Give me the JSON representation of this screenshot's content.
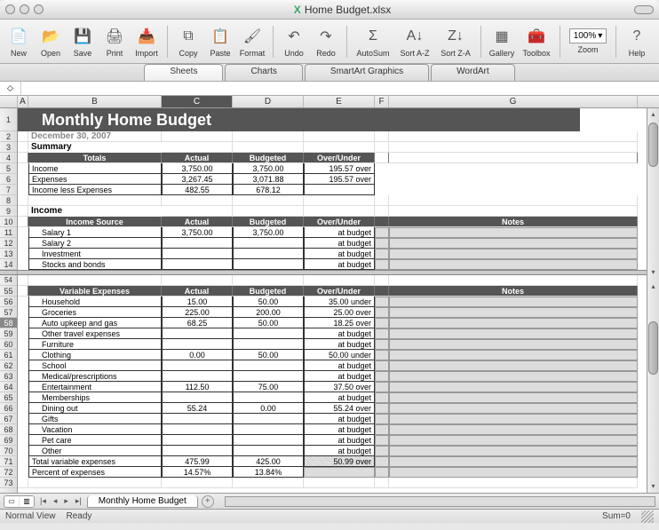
{
  "window": {
    "title": "Home Budget.xlsx"
  },
  "toolbar": {
    "items": [
      {
        "name": "new-button",
        "icon": "📄",
        "label": "New"
      },
      {
        "name": "open-button",
        "icon": "📂",
        "label": "Open"
      },
      {
        "name": "save-button",
        "icon": "💾",
        "label": "Save"
      },
      {
        "name": "print-button",
        "icon": "🖨",
        "label": "Print"
      },
      {
        "name": "import-button",
        "icon": "📥",
        "label": "Import"
      }
    ],
    "items2": [
      {
        "name": "copy-button",
        "icon": "⧉",
        "label": "Copy"
      },
      {
        "name": "paste-button",
        "icon": "📋",
        "label": "Paste"
      },
      {
        "name": "format-button",
        "icon": "🖌",
        "label": "Format"
      }
    ],
    "items3": [
      {
        "name": "undo-button",
        "icon": "↶",
        "label": "Undo"
      },
      {
        "name": "redo-button",
        "icon": "↷",
        "label": "Redo"
      }
    ],
    "items4": [
      {
        "name": "autosum-button",
        "icon": "Σ",
        "label": "AutoSum"
      },
      {
        "name": "sort-az-button",
        "icon": "A↓",
        "label": "Sort A-Z"
      },
      {
        "name": "sort-za-button",
        "icon": "Z↓",
        "label": "Sort Z-A"
      }
    ],
    "items5": [
      {
        "name": "gallery-button",
        "icon": "▦",
        "label": "Gallery"
      },
      {
        "name": "toolbox-button",
        "icon": "🧰",
        "label": "Toolbox"
      }
    ],
    "zoom": "100%",
    "zoom_label": "Zoom",
    "help_label": "Help"
  },
  "ribbon_tabs": [
    "Sheets",
    "Charts",
    "SmartArt Graphics",
    "WordArt"
  ],
  "columns": [
    "A",
    "B",
    "C",
    "D",
    "E",
    "F",
    "G"
  ],
  "selected_col": "C",
  "sheet": {
    "title": "Monthly Home Budget",
    "date": "December 30, 2007",
    "summary_label": "Summary",
    "totals_hdr": [
      "Totals",
      "Actual",
      "Budgeted",
      "Over/Under"
    ],
    "totals": [
      {
        "label": "Income",
        "actual": "3,750.00",
        "budgeted": "3,750.00",
        "ou": "195.57 over"
      },
      {
        "label": "Expenses",
        "actual": "3,267.45",
        "budgeted": "3,071.88",
        "ou": "195.57 over"
      },
      {
        "label": "Income less Expenses",
        "actual": "482.55",
        "budgeted": "678.12",
        "ou": ""
      }
    ],
    "income_label": "Income",
    "income_hdr": [
      "Income Source",
      "Actual",
      "Budgeted",
      "Over/Under",
      "Notes"
    ],
    "income": [
      {
        "label": "Salary 1",
        "actual": "3,750.00",
        "budgeted": "3,750.00",
        "ou": "at budget"
      },
      {
        "label": "Salary 2",
        "actual": "",
        "budgeted": "",
        "ou": "at budget"
      },
      {
        "label": "Investment",
        "actual": "",
        "budgeted": "",
        "ou": "at budget"
      },
      {
        "label": "Stocks and bonds",
        "actual": "",
        "budgeted": "",
        "ou": "at budget"
      }
    ],
    "varexp_hdr": [
      "Variable Expenses",
      "Actual",
      "Budgeted",
      "Over/Under",
      "Notes"
    ],
    "varexp": [
      {
        "r": "56",
        "label": "Household",
        "actual": "15.00",
        "budgeted": "50.00",
        "ou": "35.00 under"
      },
      {
        "r": "57",
        "label": "Groceries",
        "actual": "225.00",
        "budgeted": "200.00",
        "ou": "25.00 over"
      },
      {
        "r": "58",
        "label": "Auto upkeep and gas",
        "actual": "68.25",
        "budgeted": "50.00",
        "ou": "18.25 over",
        "sel": true
      },
      {
        "r": "59",
        "label": "Other travel expenses",
        "actual": "",
        "budgeted": "",
        "ou": "at budget"
      },
      {
        "r": "60",
        "label": "Furniture",
        "actual": "",
        "budgeted": "",
        "ou": "at budget"
      },
      {
        "r": "61",
        "label": "Clothing",
        "actual": "0.00",
        "budgeted": "50.00",
        "ou": "50.00 under"
      },
      {
        "r": "62",
        "label": "School",
        "actual": "",
        "budgeted": "",
        "ou": "at budget"
      },
      {
        "r": "63",
        "label": "Medical/prescriptions",
        "actual": "",
        "budgeted": "",
        "ou": "at budget"
      },
      {
        "r": "64",
        "label": "Entertainment",
        "actual": "112.50",
        "budgeted": "75.00",
        "ou": "37.50 over"
      },
      {
        "r": "65",
        "label": "Memberships",
        "actual": "",
        "budgeted": "",
        "ou": "at budget"
      },
      {
        "r": "66",
        "label": "Dining out",
        "actual": "55.24",
        "budgeted": "0.00",
        "ou": "55.24 over"
      },
      {
        "r": "67",
        "label": "Gifts",
        "actual": "",
        "budgeted": "",
        "ou": "at budget"
      },
      {
        "r": "68",
        "label": "Vacation",
        "actual": "",
        "budgeted": "",
        "ou": "at budget"
      },
      {
        "r": "69",
        "label": "Pet care",
        "actual": "",
        "budgeted": "",
        "ou": "at budget"
      },
      {
        "r": "70",
        "label": "Other",
        "actual": "",
        "budgeted": "",
        "ou": "at budget"
      }
    ],
    "totalvar": {
      "r": "71",
      "label": "Total variable expenses",
      "actual": "475.99",
      "budgeted": "425.00",
      "ou": "50.99 over"
    },
    "pctexp": {
      "r": "72",
      "label": "Percent of expenses",
      "actual": "14.57%",
      "budgeted": "13.84%"
    }
  },
  "tabs": {
    "sheet_name": "Monthly Home Budget"
  },
  "status": {
    "view": "Normal View",
    "ready": "Ready",
    "sum": "Sum=0"
  }
}
